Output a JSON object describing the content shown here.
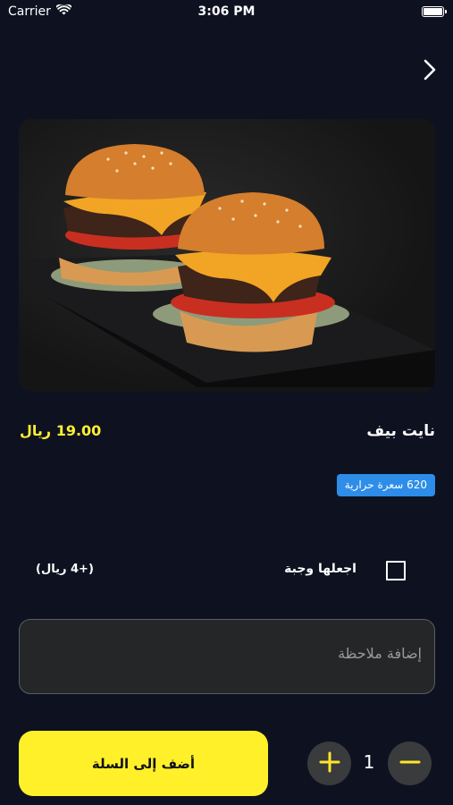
{
  "status_bar": {
    "carrier": "Carrier",
    "time": "3:06 PM"
  },
  "product": {
    "name": "نايت بيف",
    "price": "19.00 ريال",
    "calories": "620 سعرة حرارية"
  },
  "meal_option": {
    "label": "اجعلها وجبة",
    "price": "(+4 ريال)"
  },
  "note": {
    "placeholder": "إضافة ملاحظة",
    "value": ""
  },
  "quantity": {
    "value": "1"
  },
  "actions": {
    "add_to_cart_label": "أضف إلى السلة"
  },
  "colors": {
    "background": "#0e1220",
    "accent": "#fff02a",
    "price": "#ffee33",
    "badge": "#2d8de8"
  },
  "icons": {
    "back": "chevron-right-icon",
    "wifi": "wifi-icon",
    "battery": "battery-icon",
    "plus": "plus-icon",
    "minus": "minus-icon"
  }
}
